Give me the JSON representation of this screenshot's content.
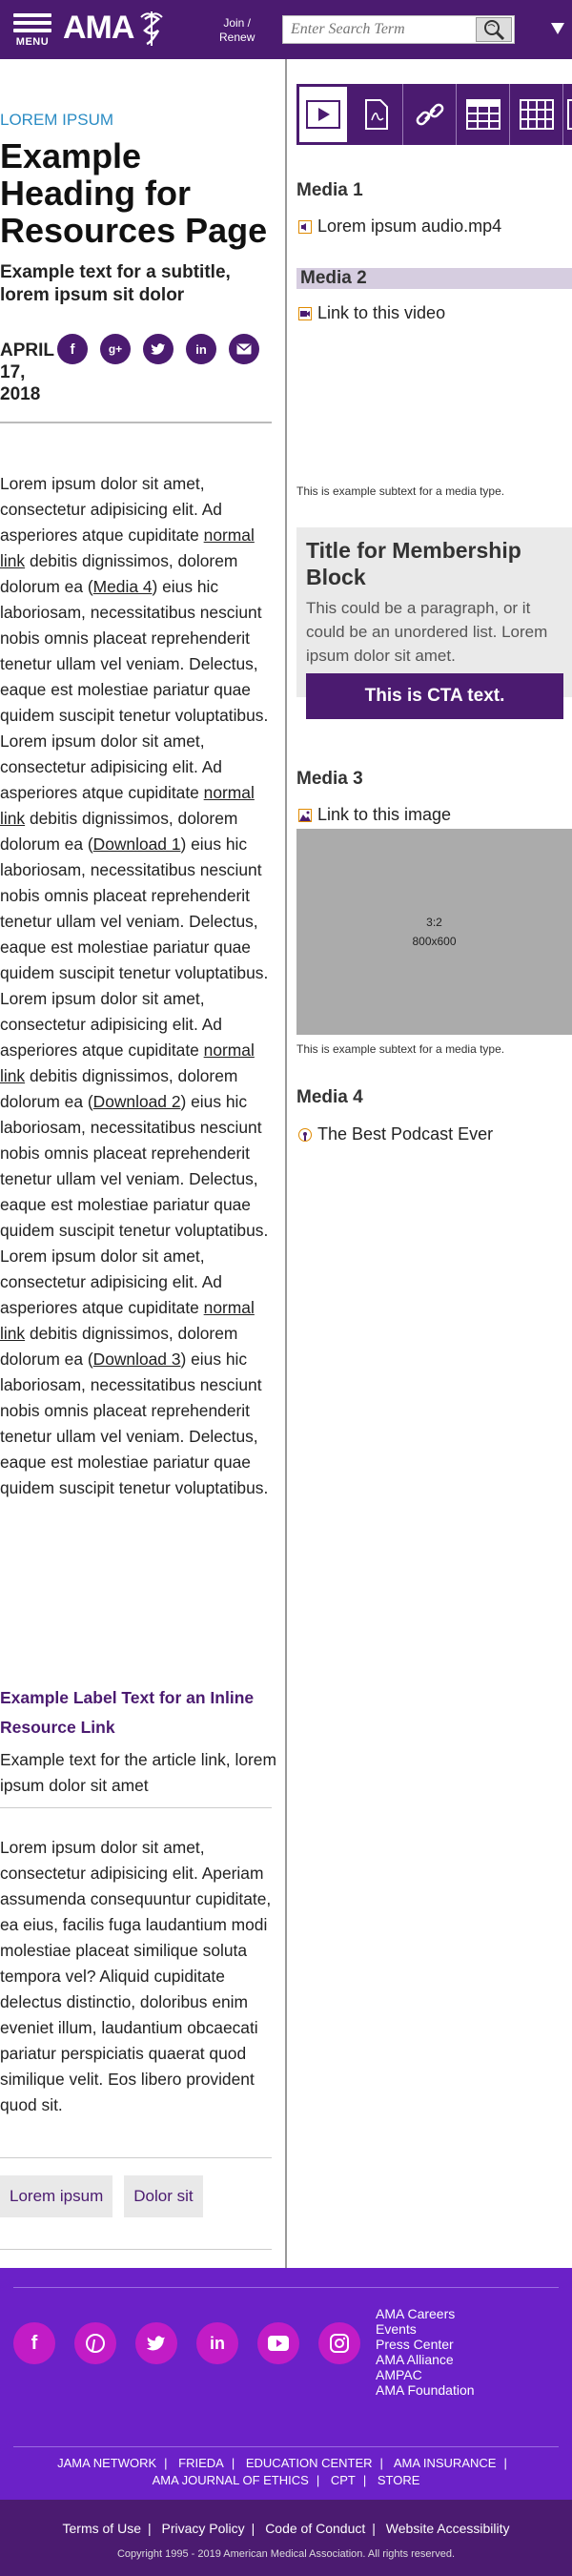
{
  "header": {
    "menu_label": "MENU",
    "logo_text": "AMA",
    "join_line1": "Join /",
    "join_line2": "Renew",
    "search_placeholder": "Enter Search Term"
  },
  "article": {
    "kicker": "LOREM IPSUM",
    "title": "Example Heading for Resources Page",
    "subtitle": "Example text for a subtitle, lorem ipsum sit dolor",
    "date": "APRIL 17, 2018",
    "share_icons": [
      "facebook",
      "google-plus",
      "twitter",
      "linkedin",
      "email"
    ]
  },
  "body": {
    "p1_a": "Lorem ipsum dolor sit amet, consectetur adipisicing elit. Ad asperiores atque cupiditate ",
    "link_normal": "normal link",
    "p1_b": " debitis dignissimos, dolorem dolorum ea (",
    "link_media4": "Media 4",
    "p1_c": ") eius hic laboriosam, necessitatibus nesciunt nobis omnis placeat reprehenderit tenetur ullam vel veniam. Delectus, eaque est molestiae pariatur quae quidem suscipit tenetur voluptatibus. Lorem ipsum dolor sit amet, consectetur adipisicing elit. Ad asperiores atque cupiditate ",
    "p1_d": " debitis dignissimos, dolorem dolorum ea (",
    "link_download1": "Download 1",
    "p1_e": ") eius hic laboriosam, necessitatibus nesciunt nobis omnis placeat reprehenderit tenetur ullam vel veniam. Delectus, eaque est molestiae pariatur quae quidem suscipit tenetur voluptatibus. Lorem ipsum dolor sit amet, consectetur adipisicing elit. Ad asperiores atque cupiditate ",
    "p1_f": " debitis dignissimos, dolorem dolorum ea (",
    "link_download2": "Download 2",
    "p1_g": ") eius hic laboriosam, necessitatibus nesciunt nobis omnis placeat reprehenderit tenetur ullam vel veniam. Delectus, eaque est molestiae pariatur quae quidem suscipit tenetur voluptatibus. Lorem ipsum dolor sit amet, consectetur adipisicing elit. Ad asperiores atque cupiditate ",
    "p1_h": " debitis dignissimos, dolorem dolorum ea (",
    "link_download3": "Download 3",
    "p1_i": ") eius hic laboriosam, necessitatibus nesciunt nobis omnis placeat reprehenderit tenetur ullam vel veniam. Delectus, eaque est molestiae pariatur quae quidem suscipit tenetur voluptatibus."
  },
  "resource_link": {
    "label": "Example Label Text for an Inline Resource Link",
    "text": "Example text for the article link, lorem ipsum dolor sit amet"
  },
  "body2": "Lorem ipsum dolor sit amet, consectetur adipisicing elit. Aperiam assumenda consequuntur cupiditate, ea eius, facilis fuga laudantium modi molestiae placeat similique soluta tempora vel? Aliquid cupiditate delectus distinctio, doloribus enim eveniet illum, laudantium obcaecati pariatur perspiciatis quaerat quod similique velit. Eos libero provident quod sit.",
  "tags": [
    "Lorem ipsum",
    "Dolor sit"
  ],
  "sidebar": {
    "tab_icons": [
      "play-icon",
      "pdf-icon",
      "link-icon",
      "table-icon",
      "grid-icon",
      "more-icon"
    ],
    "media1": {
      "heading": "Media 1",
      "link": "Lorem ipsum audio.mp4"
    },
    "media2": {
      "heading": "Media 2",
      "link": "Link to this video",
      "subtext": "This is example subtext for a media type."
    },
    "membership": {
      "title": "Title for Membership Block",
      "text": "This could be a paragraph, or it could be an unordered list. Lorem ipsum dolor sit amet.",
      "cta": "This is CTA text."
    },
    "media3": {
      "heading": "Media 3",
      "link": "Link to this image",
      "ratio": "3:2",
      "size": "800x600",
      "subtext": "This is example subtext for a media type."
    },
    "media4": {
      "heading": "Media 4",
      "link": "The Best Podcast Ever"
    }
  },
  "footer": {
    "social": [
      "facebook",
      "pinterest",
      "twitter",
      "linkedin",
      "youtube",
      "instagram"
    ],
    "links": [
      "AMA Careers",
      "Events",
      "Press Center",
      "AMA Alliance",
      "AMPAC",
      "AMA Foundation"
    ],
    "bar_links": [
      "JAMA NETWORK",
      "FRIEDA",
      "EDUCATION CENTER",
      "AMA INSURANCE",
      "AMA JOURNAL OF ETHICS",
      "CPT",
      "STORE"
    ],
    "legal": [
      "Terms of Use",
      "Privacy Policy",
      "Code of Conduct",
      "Website Accessibility"
    ],
    "copyright": "Copyright 1995 - 2019 American Medical Association. All rights reserved."
  },
  "colors": {
    "brand_purple": "#4b1b70",
    "footer_purple": "#6b21c8",
    "social_magenta": "#c21cc6",
    "kicker_blue": "#2b8cc4"
  }
}
